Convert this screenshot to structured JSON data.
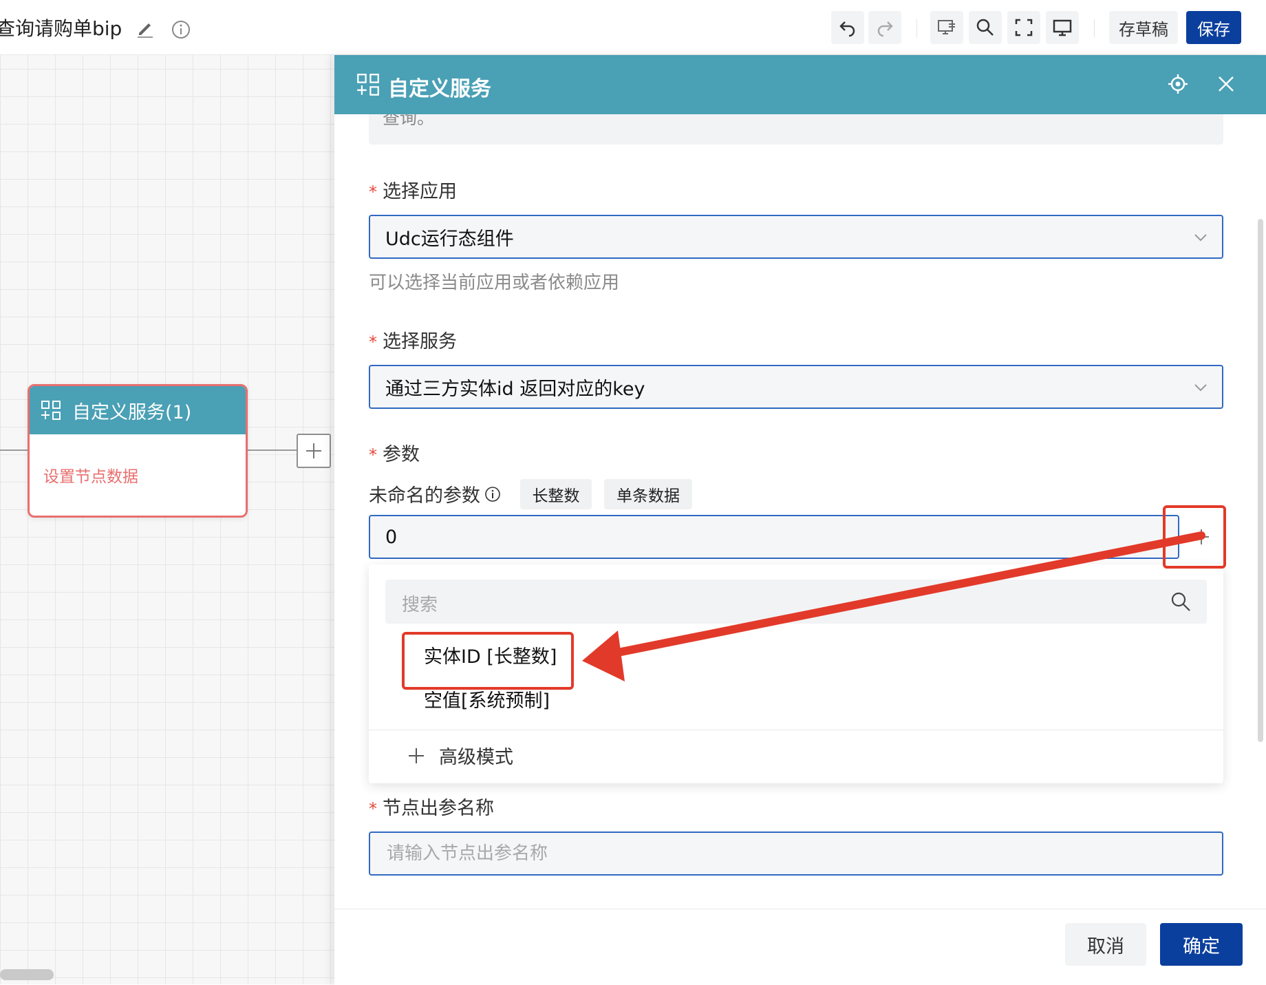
{
  "topbar": {
    "title": "查询请购单bip",
    "draft_label": "存草稿",
    "save_label": "保存",
    "icons": [
      "edit-icon",
      "info-icon",
      "undo-icon",
      "redo-icon",
      "preview-icon",
      "search-icon",
      "fullscreen-icon",
      "monitor-icon"
    ]
  },
  "canvas": {
    "node": {
      "title": "自定义服务(1)",
      "body": "设置节点数据"
    }
  },
  "drawer": {
    "title": "自定义服务",
    "description_fragment": "查询。",
    "app_section": {
      "label": "选择应用",
      "required_mark": "*",
      "value": "Udc运行态组件",
      "hint": "可以选择当前应用或者依赖应用"
    },
    "service_section": {
      "label": "选择服务",
      "required_mark": "*",
      "value": "通过三方实体id 返回对应的key"
    },
    "params_section": {
      "label": "参数",
      "required_mark": "*",
      "param_name": "未命名的参数",
      "tags": [
        "长整数",
        "单条数据"
      ],
      "value": "0"
    },
    "dropdown": {
      "search_placeholder": "搜索",
      "options": [
        "实体ID [长整数]",
        "空值[系统预制]"
      ],
      "advanced_label": "高级模式"
    },
    "output_section": {
      "label": "节点出参名称",
      "required_mark": "*",
      "placeholder": "请输入节点出参名称"
    },
    "footer": {
      "cancel_label": "取消",
      "ok_label": "确定"
    }
  },
  "colors": {
    "header_teal": "#4aa0b5",
    "primary_blue": "#0b3f9e",
    "input_border": "#2f69c2",
    "node_border": "#e86f6f",
    "annotation_red": "#e23a2a"
  }
}
